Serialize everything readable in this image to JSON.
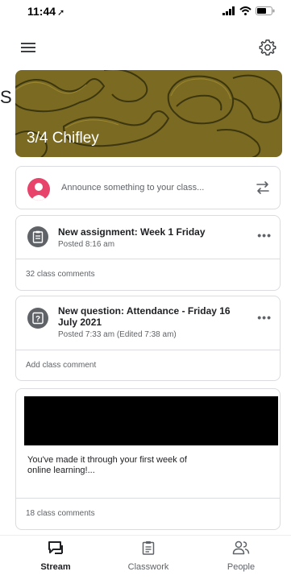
{
  "status_bar": {
    "time": "11:44",
    "location_arrow": "➚"
  },
  "header": {
    "menu_icon": "hamburger-menu-icon",
    "settings_icon": "gear-icon"
  },
  "banner": {
    "class_name": "3/4 Chifley",
    "edge_fragment": "S",
    "theme_color": "#7a6a22"
  },
  "announce": {
    "placeholder": "Announce something to your class..."
  },
  "posts": [
    {
      "title": "New assignment: Week 1 Friday",
      "subtitle": "Posted 8:16 am",
      "comments": "32 class comments",
      "icon": "assignment-icon"
    },
    {
      "title_line1": "New question: Attendance - Friday 16",
      "title_line2": "July 2021",
      "subtitle": "Posted 7:33 am (Edited 7:38 am)",
      "comments": "Add class comment",
      "icon": "question-icon"
    },
    {
      "text_line1": "You've made it through your first week of",
      "text_line2": "online learning!...",
      "comments": "18 class comments"
    }
  ],
  "bottom_nav": {
    "items": [
      {
        "label": "Stream",
        "icon": "stream-icon",
        "active": true
      },
      {
        "label": "Classwork",
        "icon": "classwork-icon",
        "active": false
      },
      {
        "label": "People",
        "icon": "people-icon",
        "active": false
      }
    ]
  }
}
